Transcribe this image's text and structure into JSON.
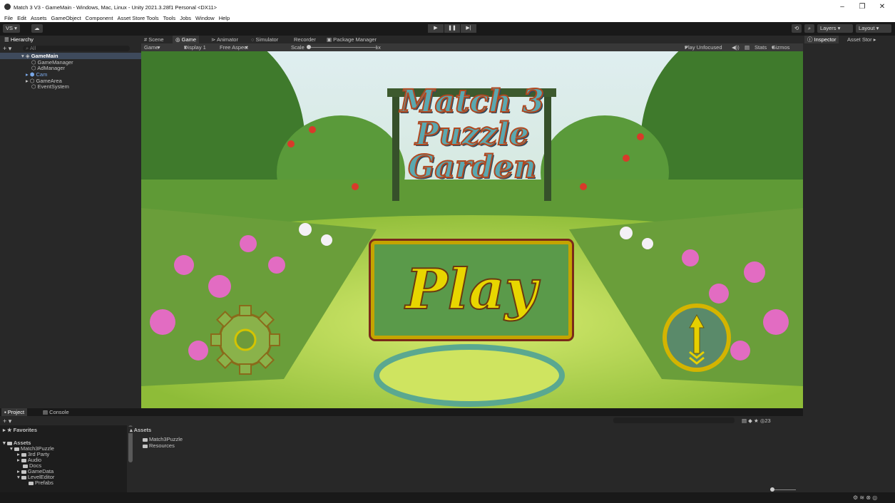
{
  "window": {
    "title": "Match 3 V3 - GameMain - Windows, Mac, Linux - Unity 2021.3.28f1 Personal <DX11>",
    "minimize": "–",
    "maximize": "❐",
    "close": "✕"
  },
  "menu": [
    "File",
    "Edit",
    "Assets",
    "GameObject",
    "Component",
    "Asset Store Tools",
    "Tools",
    "Jobs",
    "Window",
    "Help"
  ],
  "toolbar": {
    "account": "VS ▾",
    "cloud": "☁",
    "play": "▶",
    "pause": "❚❚",
    "step": "▶|",
    "layers": "Layers",
    "layout": "Layout"
  },
  "hierarchy": {
    "tab": "Hierarchy",
    "search": "All",
    "items": [
      {
        "label": "GameMain",
        "indent": 0
      },
      {
        "label": "GameManager",
        "indent": 1
      },
      {
        "label": "AdManager",
        "indent": 1
      },
      {
        "label": "Cam",
        "indent": 1
      },
      {
        "label": "GameArea",
        "indent": 1
      },
      {
        "label": "EventSystem",
        "indent": 1
      }
    ]
  },
  "center_tabs": [
    "Scene",
    "Game",
    "Animator",
    "Simulator",
    "Recorder",
    "Package Manager"
  ],
  "game_bar": {
    "mode": "Game",
    "display": "Display 1",
    "aspect": "Free Aspect",
    "scale_label": "Scale",
    "scale_value": "1x",
    "play_focus": "Play Unfocused",
    "stats": "Stats",
    "gizmos": "Gizmos"
  },
  "game": {
    "title_lines": [
      "Match 3",
      "Puzzle",
      "Garden"
    ],
    "play": "Play"
  },
  "right_tabs": [
    "Inspector",
    "Asset Stor"
  ],
  "bottom": {
    "tabs": [
      "Project",
      "Console"
    ],
    "favorites": "Favorites",
    "assets_root": "Assets",
    "tree": [
      "Match3Puzzle",
      "3rd Party",
      "Audio",
      "Docs",
      "GameData",
      "LevelEditor",
      "Prefabs"
    ],
    "breadcrumb": "Assets",
    "contents": [
      "Match3Puzzle",
      "Resources"
    ],
    "count": "23"
  },
  "colors": {
    "bg": "#191919",
    "panel": "#282828",
    "gold": "#d4c400",
    "accent": "#4a6b9a"
  }
}
